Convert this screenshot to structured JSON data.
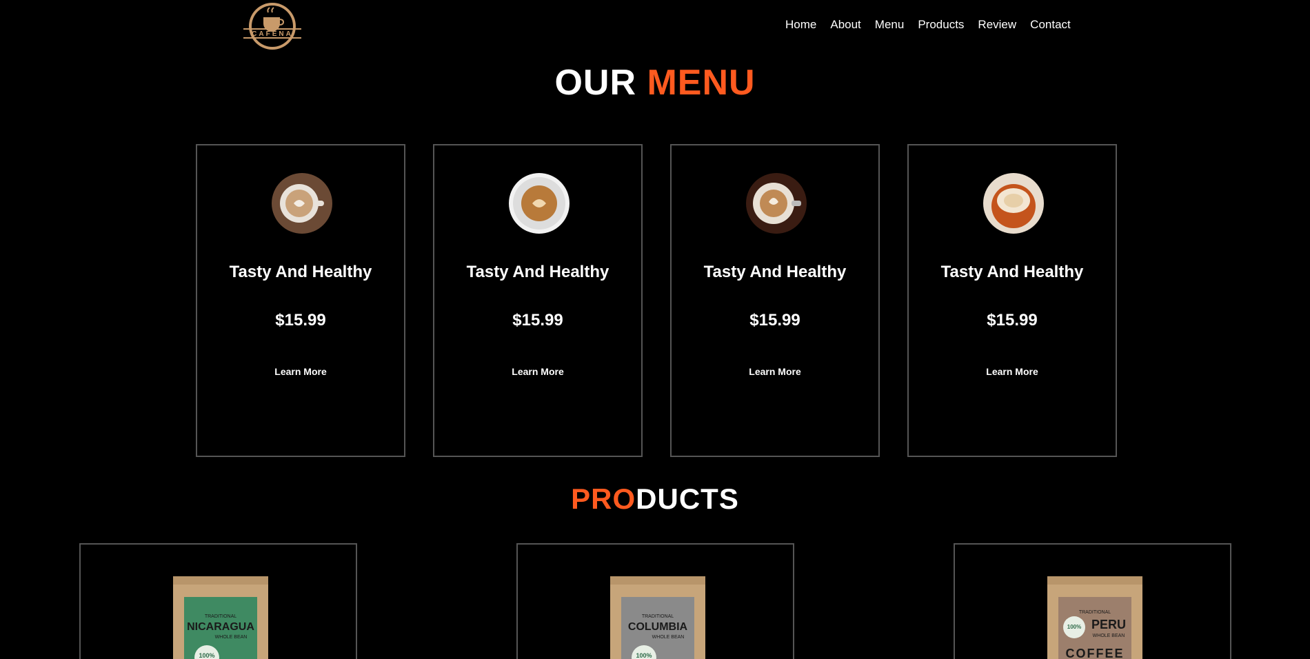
{
  "brand": {
    "logo_text": "CAFENA"
  },
  "nav": {
    "items": [
      {
        "label": "Home"
      },
      {
        "label": "About"
      },
      {
        "label": "Menu"
      },
      {
        "label": "Products"
      },
      {
        "label": "Review"
      },
      {
        "label": "Contact"
      }
    ]
  },
  "menu_section": {
    "title_white": "OUR ",
    "title_accent": "MENU",
    "cards": [
      {
        "name": "Tasty And Healthy",
        "price": "$15.99",
        "cta": "Learn More"
      },
      {
        "name": "Tasty And Healthy",
        "price": "$15.99",
        "cta": "Learn More"
      },
      {
        "name": "Tasty And Healthy",
        "price": "$15.99",
        "cta": "Learn More"
      },
      {
        "name": "Tasty And Healthy",
        "price": "$15.99",
        "cta": "Learn More"
      }
    ]
  },
  "products_section": {
    "title_accent": "PRO",
    "title_white": "DUCTS",
    "products": [
      {
        "label_top": "TRADITIONAL",
        "name": "NICARAGUA",
        "sub": "WHOLE BEAN",
        "badge": "100%",
        "label_color": "#3f8a62"
      },
      {
        "label_top": "TRADITIONAL",
        "name": "COLUMBIA",
        "sub": "WHOLE BEAN",
        "badge": "100%",
        "label_color": "#8a8a8a"
      },
      {
        "label_top": "TRADITIONAL",
        "name": "PERU",
        "sub": "WHOLE BEAN",
        "badge": "100%",
        "extra": "COFFEE",
        "label_color": "#9c7f6c"
      }
    ]
  },
  "colors": {
    "accent": "#ff5a1f",
    "background": "#000000",
    "card_border": "#555555",
    "kraft": "#c7a57a"
  }
}
